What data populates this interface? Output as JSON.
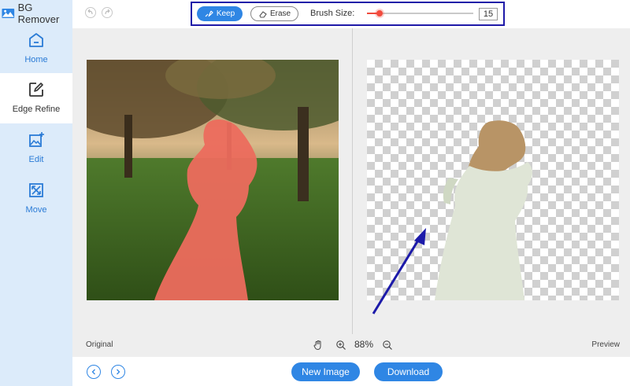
{
  "app": {
    "title": "BG Remover"
  },
  "sidebar": {
    "items": [
      {
        "label": "Home",
        "icon": "home-icon",
        "active": false
      },
      {
        "label": "Edge Refine",
        "icon": "edge-refine-icon",
        "active": true
      },
      {
        "label": "Edit",
        "icon": "edit-icon",
        "active": false
      },
      {
        "label": "Move",
        "icon": "move-icon",
        "active": false
      }
    ]
  },
  "toolbar": {
    "keep_label": "Keep",
    "erase_label": "Erase",
    "brush_size_label": "Brush Size:",
    "brush_size_value": "15",
    "brush_fraction": 0.12,
    "highlight_color": "#1e19a8",
    "accent_color": "#2f86e4",
    "slider_color": "#f04a3c"
  },
  "workspace": {
    "original_label": "Original",
    "preview_label": "Preview",
    "zoom": "88%"
  },
  "footer": {
    "new_image_label": "New Image",
    "download_label": "Download"
  }
}
